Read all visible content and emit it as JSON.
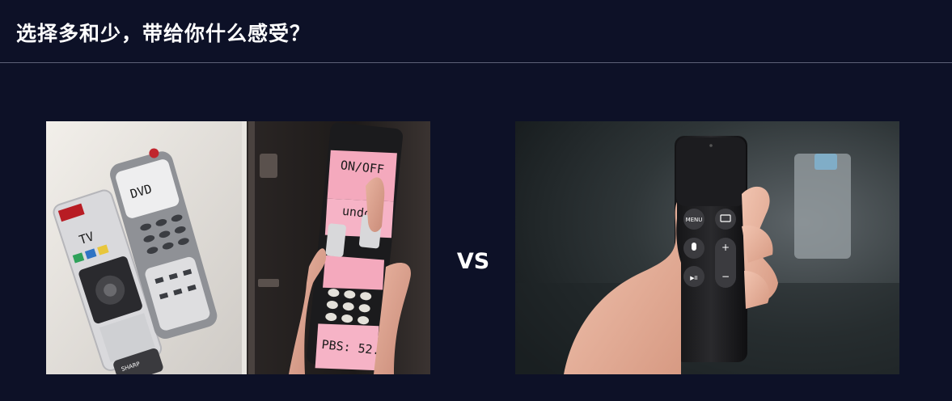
{
  "slide": {
    "title": "选择多和少，带给你什么感受？",
    "vs_label": "VS"
  },
  "left_photo": {
    "tv_label": "TV",
    "dvd_label": "DVD",
    "sharp_label": "SHARP",
    "on_off_label": "ON/OFF",
    "undo_label": "undo",
    "pbs_label": "PBS: 52.2"
  },
  "right_photo": {
    "menu_label": "MENU",
    "plus_label": "+",
    "minus_label": "−",
    "play_label": "▶II"
  }
}
